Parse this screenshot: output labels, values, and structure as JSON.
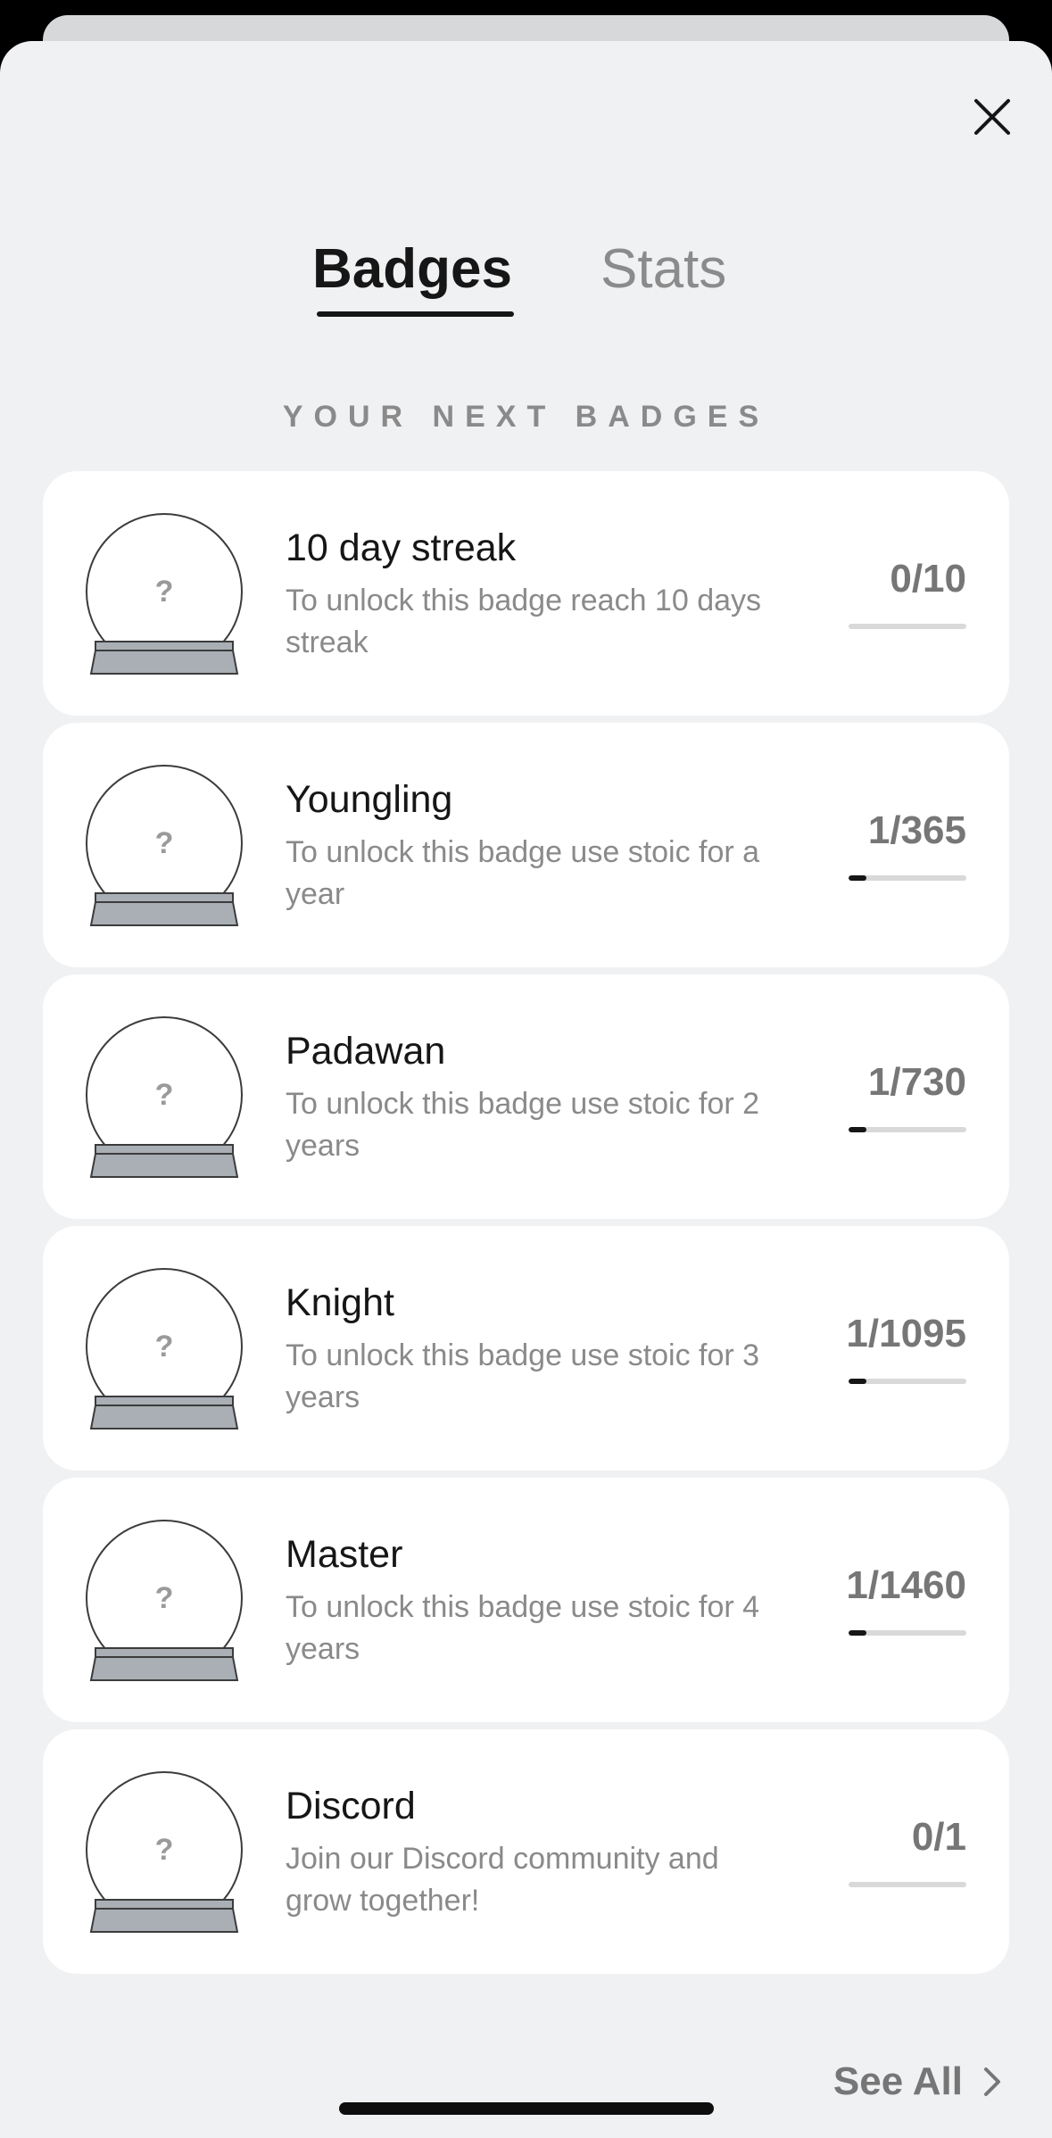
{
  "header": {
    "close_icon": "close-icon"
  },
  "tabs": [
    {
      "label": "Badges",
      "active": true
    },
    {
      "label": "Stats",
      "active": false
    }
  ],
  "section": {
    "title": "YOUR NEXT BADGES"
  },
  "badges": [
    {
      "title": "10 day streak",
      "description": "To unlock this badge reach 10 days streak",
      "progress_label": "0/10",
      "progress": 0.0,
      "icon": "locked-badge-globe-icon",
      "icon_glyph": "?"
    },
    {
      "title": "Youngling",
      "description": "To unlock this badge use stoic for a year",
      "progress_label": "1/365",
      "progress": 0.15,
      "icon": "locked-badge-globe-icon",
      "icon_glyph": "?"
    },
    {
      "title": "Padawan",
      "description": "To unlock this badge use stoic for 2 years",
      "progress_label": "1/730",
      "progress": 0.15,
      "icon": "locked-badge-globe-icon",
      "icon_glyph": "?"
    },
    {
      "title": "Knight",
      "description": "To unlock this badge use stoic for 3 years",
      "progress_label": "1/1095",
      "progress": 0.15,
      "icon": "locked-badge-globe-icon",
      "icon_glyph": "?"
    },
    {
      "title": "Master",
      "description": "To unlock this badge use stoic for 4 years",
      "progress_label": "1/1460",
      "progress": 0.15,
      "icon": "locked-badge-globe-icon",
      "icon_glyph": "?"
    },
    {
      "title": "Discord",
      "description": "Join our Discord community and grow together!",
      "progress_label": "0/1",
      "progress": 0.0,
      "icon": "locked-badge-globe-icon",
      "icon_glyph": "?"
    }
  ],
  "footer": {
    "see_all_label": "See All",
    "see_all_icon": "chevron-right-icon"
  },
  "colors": {
    "background": "#f0f1f3",
    "card": "#ffffff",
    "primary_text": "#161616",
    "secondary_text": "#8a8a8a",
    "progress_fill": "#161616",
    "progress_track": "#d9d9d9",
    "badge_base": "#a9afb5"
  }
}
